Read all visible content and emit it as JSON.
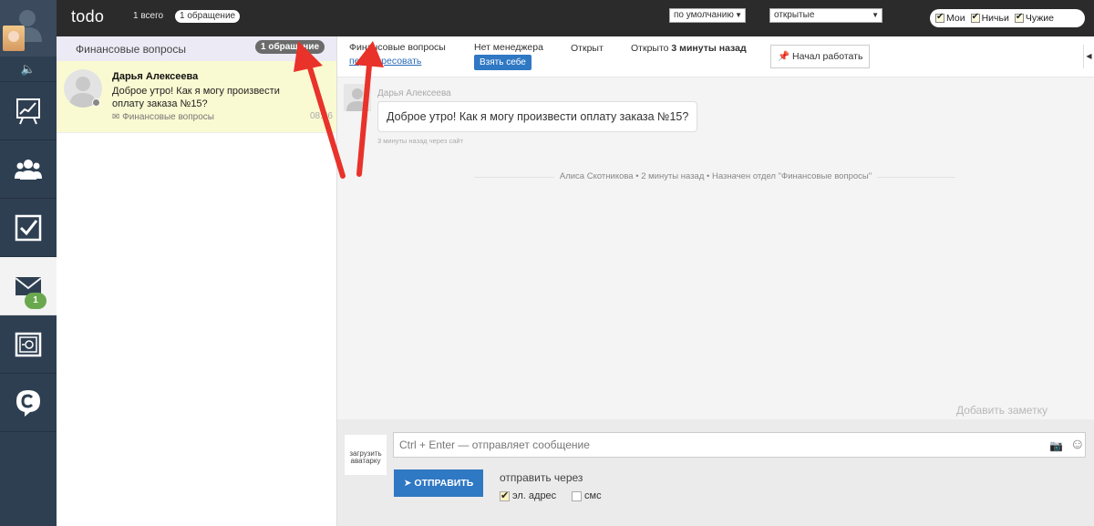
{
  "app": {
    "title": "todo"
  },
  "topbar": {
    "total": "1 всего",
    "appeals": "1 обращение",
    "sort_select": "по умолчанию",
    "status_select": "открытые",
    "filters": [
      {
        "label": "Мои",
        "checked": true
      },
      {
        "label": "Ничьи",
        "checked": true
      },
      {
        "label": "Чужие",
        "checked": true
      }
    ]
  },
  "sidebar": {
    "mail_badge": "1",
    "items": [
      {
        "name": "analytics"
      },
      {
        "name": "clients"
      },
      {
        "name": "tasks"
      },
      {
        "name": "mail"
      },
      {
        "name": "safe"
      },
      {
        "name": "chat"
      }
    ]
  },
  "list": {
    "header_title": "Финансовые вопросы",
    "header_count": "1 обращение",
    "conversations": [
      {
        "name": "Дарья Алексеева",
        "text": "Доброе утро! Как я могу произвести оплату заказа №15?",
        "tag": "Финансовые вопросы",
        "time": "08:36"
      }
    ]
  },
  "chat": {
    "department": "Финансовые вопросы",
    "readdress": "переадресовать",
    "no_manager": "Нет менеджера",
    "take_button": "Взять себе",
    "state": "Открыт",
    "opened_prefix": "Открыто",
    "opened_time": "3 минуты назад",
    "start_button": "Начал работать",
    "message": {
      "author": "Дарья Алексеева",
      "text": "Доброе утро! Как я могу произвести оплату заказа №15?",
      "meta": "3 минуты назад через сайт"
    },
    "system_event": "Алиса Скотникова • 2 минуты назад • Назначен отдел \"Финансовые вопросы\"",
    "add_note": "Добавить заметку"
  },
  "composer": {
    "avatar_caption": "загрузить аватарку",
    "placeholder": "Ctrl + Enter — отправляет сообщение",
    "send_button": "ОТПРАВИТЬ",
    "send_via": "отправить через",
    "email_label": "эл. адрес",
    "email_checked": true,
    "sms_label": "смс",
    "sms_checked": false
  },
  "colors": {
    "rail": "#2f3f52",
    "topbar": "#2b2b2b",
    "accent": "#2f78c4",
    "badge_green": "#6aa84f",
    "highlight_row": "#fafad2",
    "annotation_red": "#e8322a"
  }
}
